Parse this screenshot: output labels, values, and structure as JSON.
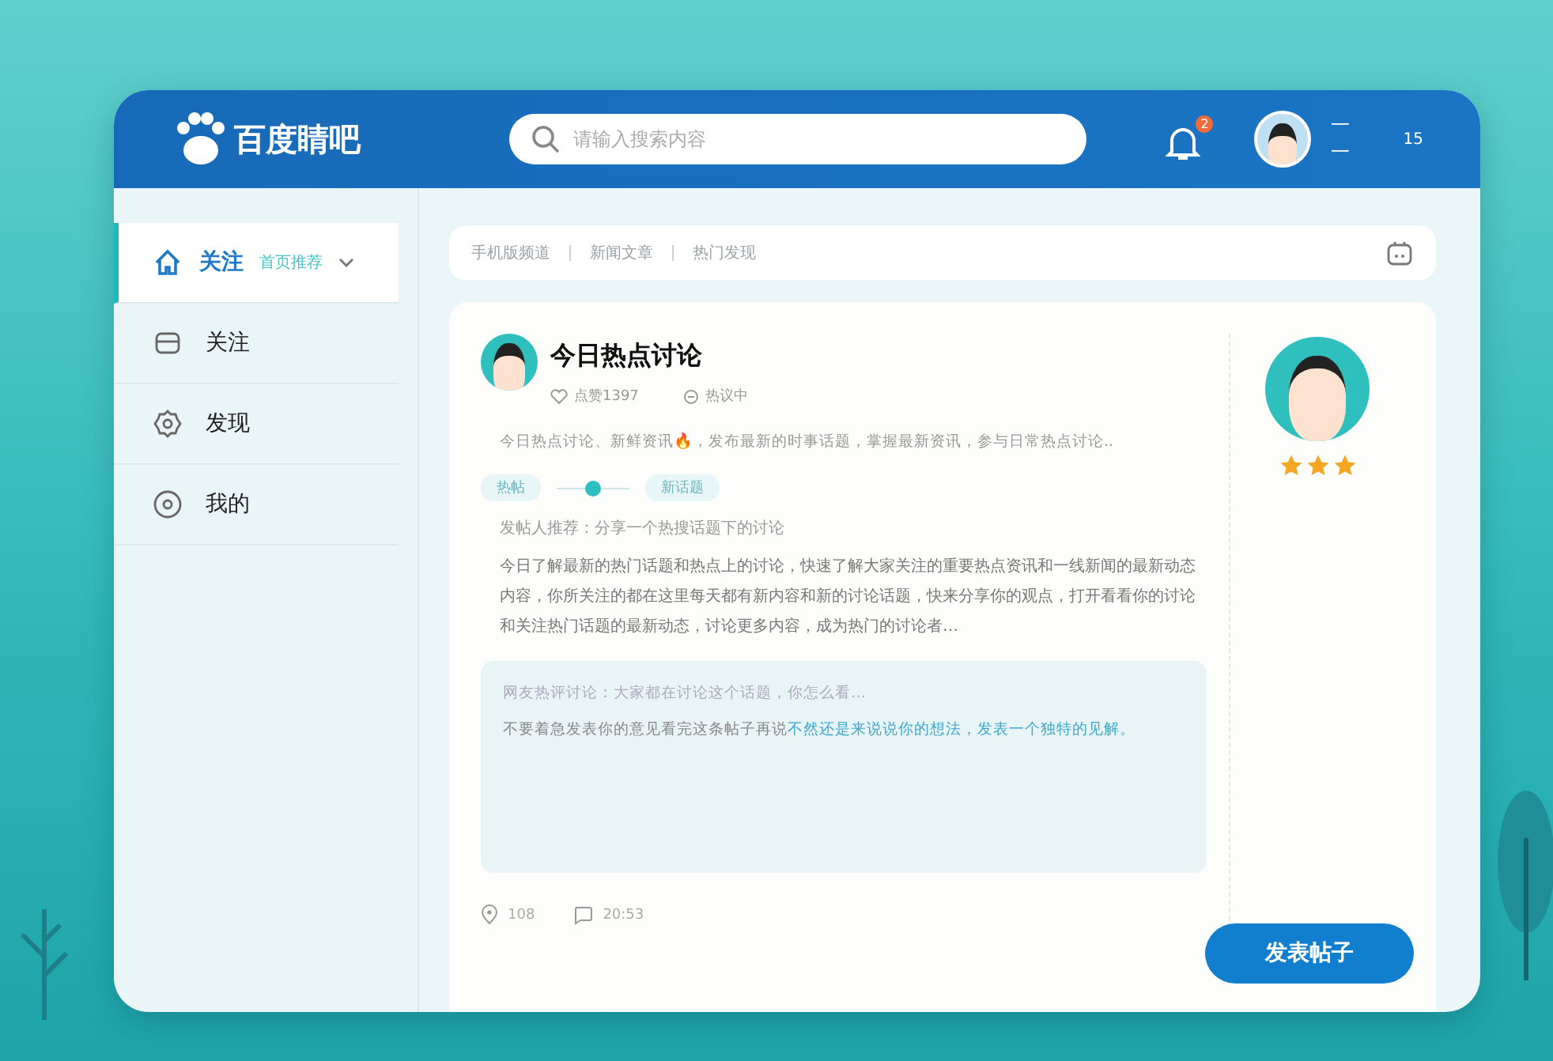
{
  "header": {
    "logo": "百度睛吧",
    "search": {
      "placeholder": "请输入搜索内容"
    },
    "notifications": "2",
    "user": {
      "name": "一一",
      "level": "15"
    }
  },
  "sidebar": {
    "items": [
      {
        "label": "关注",
        "sub": "首页推荐",
        "selected": true,
        "kind": "home"
      },
      {
        "label": "关注",
        "selected": false,
        "kind": "box"
      },
      {
        "label": "发现",
        "selected": false,
        "kind": "gear"
      },
      {
        "label": "我的",
        "selected": false,
        "kind": "pin"
      }
    ]
  },
  "breadcrumbs": [
    "手机版频道",
    "新闻文章",
    "热门发现"
  ],
  "post": {
    "title": "今日热点讨论",
    "likes": "点赞1397",
    "status": "热议中",
    "summary": "今日热点讨论、新鲜资讯🔥，发布最新的时事话题，掌握最新资讯，参与日常热点讨论..",
    "tags": [
      "热帖",
      "新话题"
    ],
    "subtitle": "发帖人推荐：分享一个热搜话题下的讨论",
    "body": "今日了解最新的热门话题和热点上的讨论，快速了解大家关注的重要热点资讯和一线新闻的最新动态内容，你所关注的都在这里每天都有新内容和新的讨论话题，快来分享你的观点，打开看看你的讨论和关注热门话题的最新动态，讨论更多内容，成为热门的讨论者…",
    "quote": {
      "note": "网友热评讨论：大家都在讨论这个话题，你怎么看…",
      "text": "不要着急发表你的意见看完这条帖子再说",
      "link": "不然还是来说说你的想法，发表一个独特的见解。"
    },
    "location": "108",
    "time": "20:53",
    "stars": 3
  },
  "button": "发表帖子"
}
